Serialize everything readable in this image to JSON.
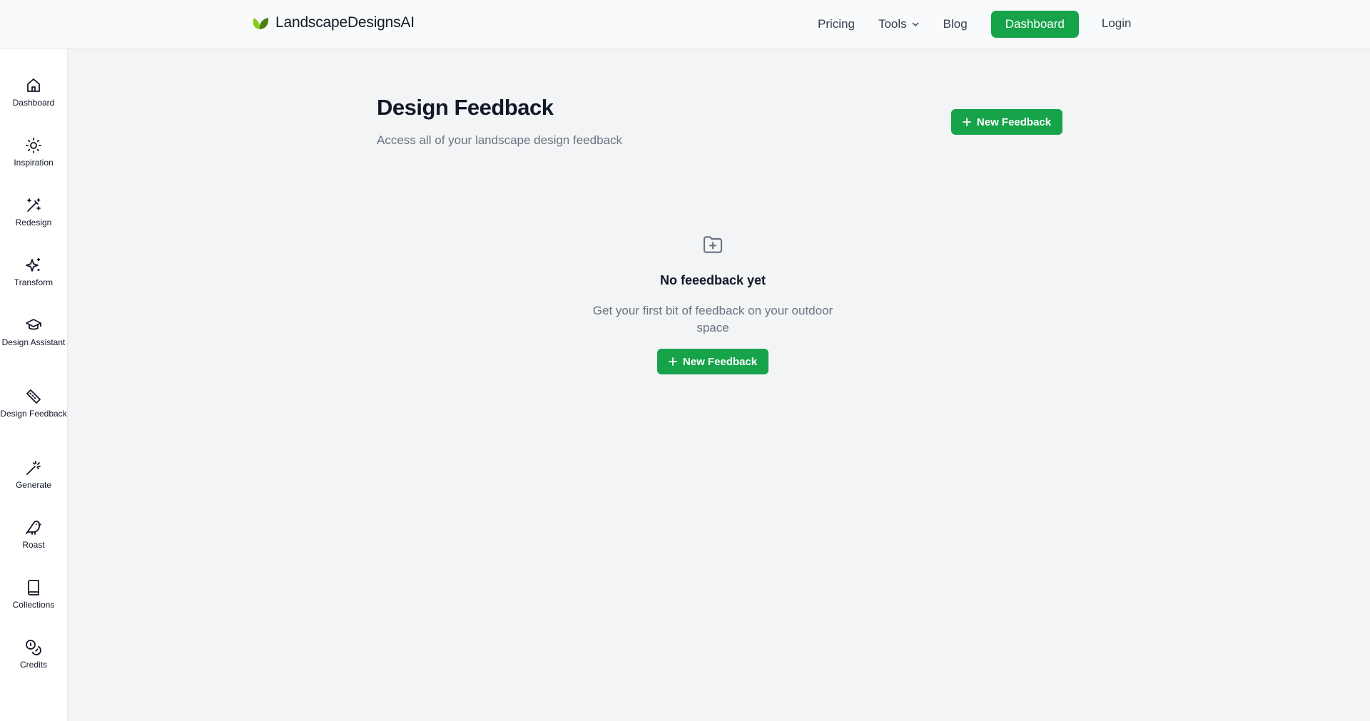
{
  "header": {
    "brand": "LandscapeDesignsAI",
    "nav": {
      "pricing": "Pricing",
      "tools": "Tools",
      "blog": "Blog",
      "dashboard": "Dashboard",
      "login": "Login"
    }
  },
  "sidebar": {
    "items": [
      {
        "label": "Dashboard",
        "icon": "home-icon"
      },
      {
        "label": "Inspiration",
        "icon": "sun-icon"
      },
      {
        "label": "Redesign",
        "icon": "magic-wand-icon"
      },
      {
        "label": "Transform",
        "icon": "sparkles-icon"
      },
      {
        "label": "Design Assistant",
        "icon": "graduation-cap-icon"
      },
      {
        "label": "Design Feedback",
        "icon": "ruler-icon"
      },
      {
        "label": "Generate",
        "icon": "wand-icon"
      },
      {
        "label": "Roast",
        "icon": "bird-icon"
      },
      {
        "label": "Collections",
        "icon": "book-icon"
      },
      {
        "label": "Credits",
        "icon": "coins-icon"
      }
    ]
  },
  "main": {
    "title": "Design Feedback",
    "subtitle": "Access all of your landscape design feedback",
    "new_feedback_label": "New Feedback",
    "empty_state": {
      "icon": "folder-plus-icon",
      "title": "No feeedback yet",
      "text": "Get your first bit of feedback on your outdoor space",
      "button_label": "New Feedback"
    }
  },
  "colors": {
    "accent": "#16a34a",
    "background": "#f3f4f6",
    "muted_text": "#6b7280"
  }
}
